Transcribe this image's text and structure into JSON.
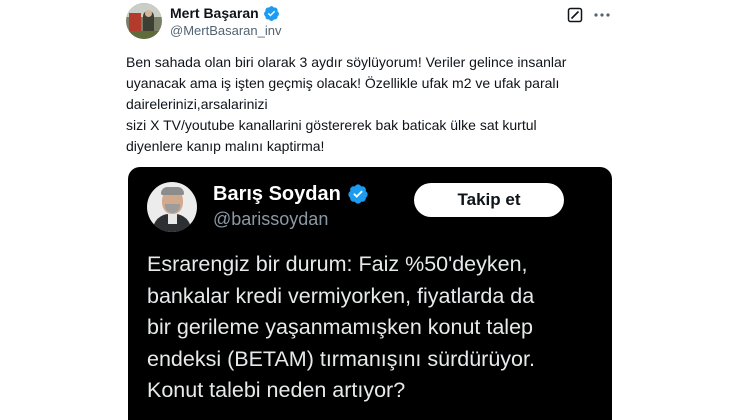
{
  "post": {
    "author": {
      "name": "Mert Başaran",
      "handle": "@MertBasaran_inv",
      "verified": true
    },
    "icons": [
      "avatar",
      "verified-badge-icon",
      "grok-icon",
      "more-icon"
    ],
    "text": "Ben sahada olan biri olarak 3 aydır söylüyorum! Veriler gelince insanlar\nuyanacak ama iş işten geçmiş olacak! Özellikle ufak m2 ve ufak paralı\ndairelerinizi,arsalarinizi\n sizi X TV/youtube kanallarini göstererek bak baticak ülke  sat kurtul\ndiyenlere kanıp malını kaptirma!"
  },
  "quote": {
    "author": {
      "name": "Barış Soydan",
      "handle": "@barissoydan",
      "verified": true
    },
    "follow_label": "Takip et",
    "text": "Esrarengiz bir durum: Faiz %50'deyken,\nbankalar kredi vermiyorken, fiyatlarda da\nbir gerileme yaşanmamışken konut talep\nendeksi (BETAM) tırmanışını sürdürüyor.\nKonut talebi neden artıyor?"
  },
  "colors": {
    "verified_blue": "#1d9bf0",
    "text_primary": "#0f1419",
    "text_secondary": "#536471",
    "quote_background": "#000000",
    "quote_text": "#e7e9ea",
    "quote_handle": "#8b98a5"
  }
}
